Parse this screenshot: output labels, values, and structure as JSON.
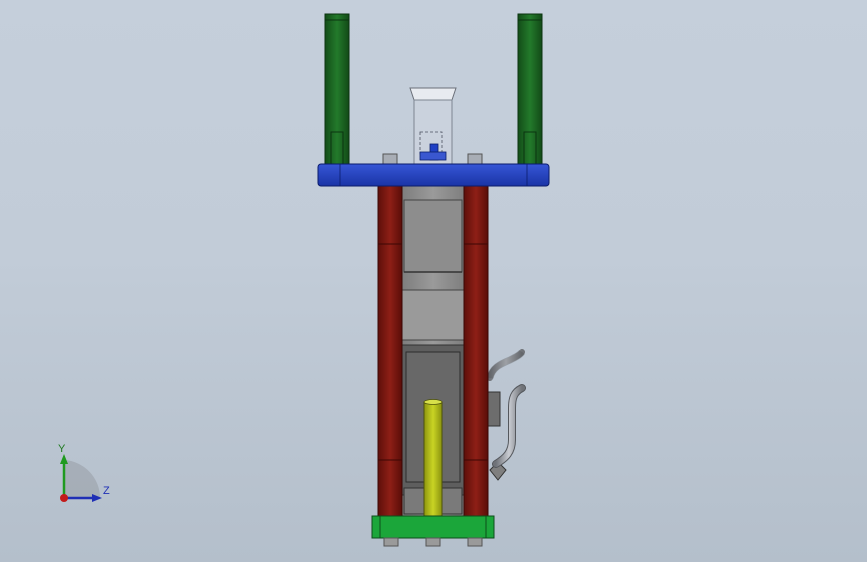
{
  "view": {
    "background_top": "#c5cfdb",
    "background_bottom": "#b4bfcb"
  },
  "colors": {
    "top_plate": "#1f3fc4",
    "guide_pillars": "#1d6b24",
    "tie_rods": "#7a1610",
    "bottom_plate": "#1ba63a",
    "core_pin": "#b7c21a",
    "machine_body": "#8c8c8c",
    "hopper": "#dfe3ea"
  },
  "triad": {
    "y_label": "Y",
    "z_label": "Z",
    "y_color": "#1f7a1f",
    "z_color": "#1f2fb5",
    "x_color": "#c21a1a"
  }
}
